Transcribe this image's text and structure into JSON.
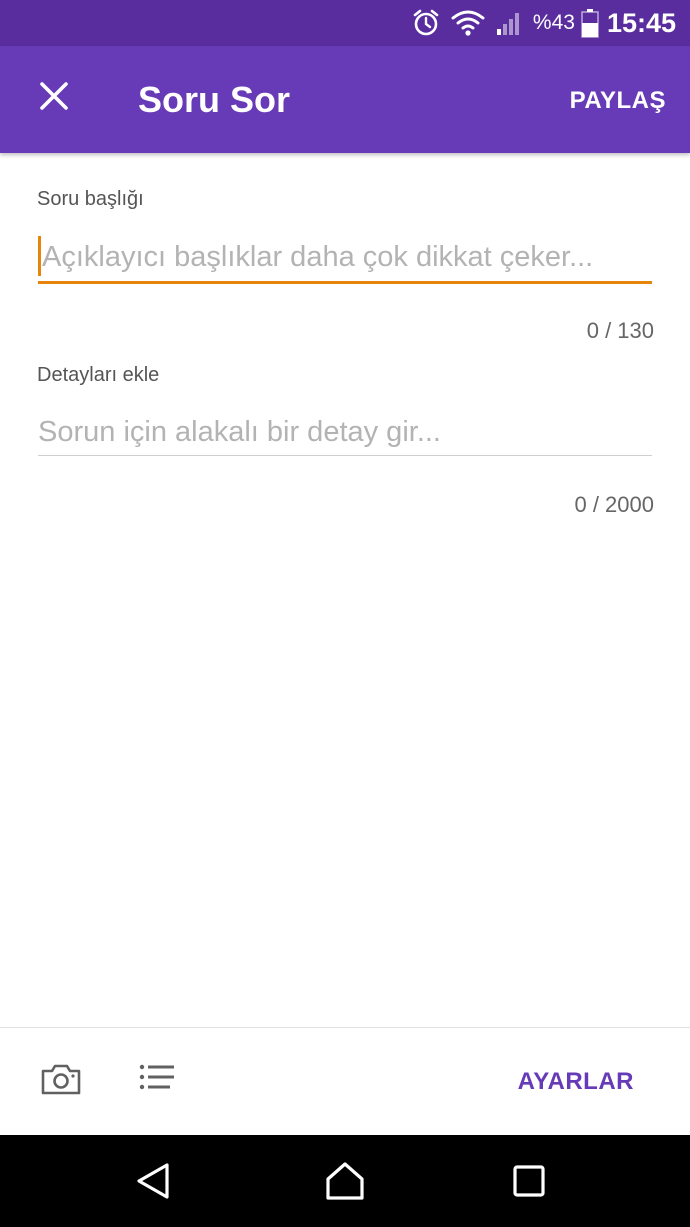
{
  "status_bar": {
    "battery_percent": "%43",
    "time": "15:45",
    "icons": [
      "alarm-icon",
      "wifi-icon",
      "signal-icon",
      "battery-icon"
    ]
  },
  "app_bar": {
    "title": "Soru Sor",
    "share_label": "PAYLAŞ",
    "close_icon": "close-icon"
  },
  "form": {
    "title_label": "Soru başlığı",
    "title_placeholder": "Açıklayıcı başlıklar daha çok dikkat çeker...",
    "title_value": "",
    "title_counter": "0 / 130",
    "details_label": "Detayları ekle",
    "details_placeholder": "Sorun için alakalı bir detay gir...",
    "details_value": "",
    "details_counter": "0 / 2000"
  },
  "toolbar": {
    "settings_label": "AYARLAR",
    "icons": [
      "camera-icon",
      "list-icon"
    ]
  },
  "navigation": {
    "icons": [
      "back-icon",
      "home-icon",
      "recents-icon"
    ]
  },
  "colors": {
    "status_bar": "#5a2d9f",
    "app_bar": "#673ab7",
    "accent": "#e6850b",
    "settings_text": "#673ab7"
  }
}
